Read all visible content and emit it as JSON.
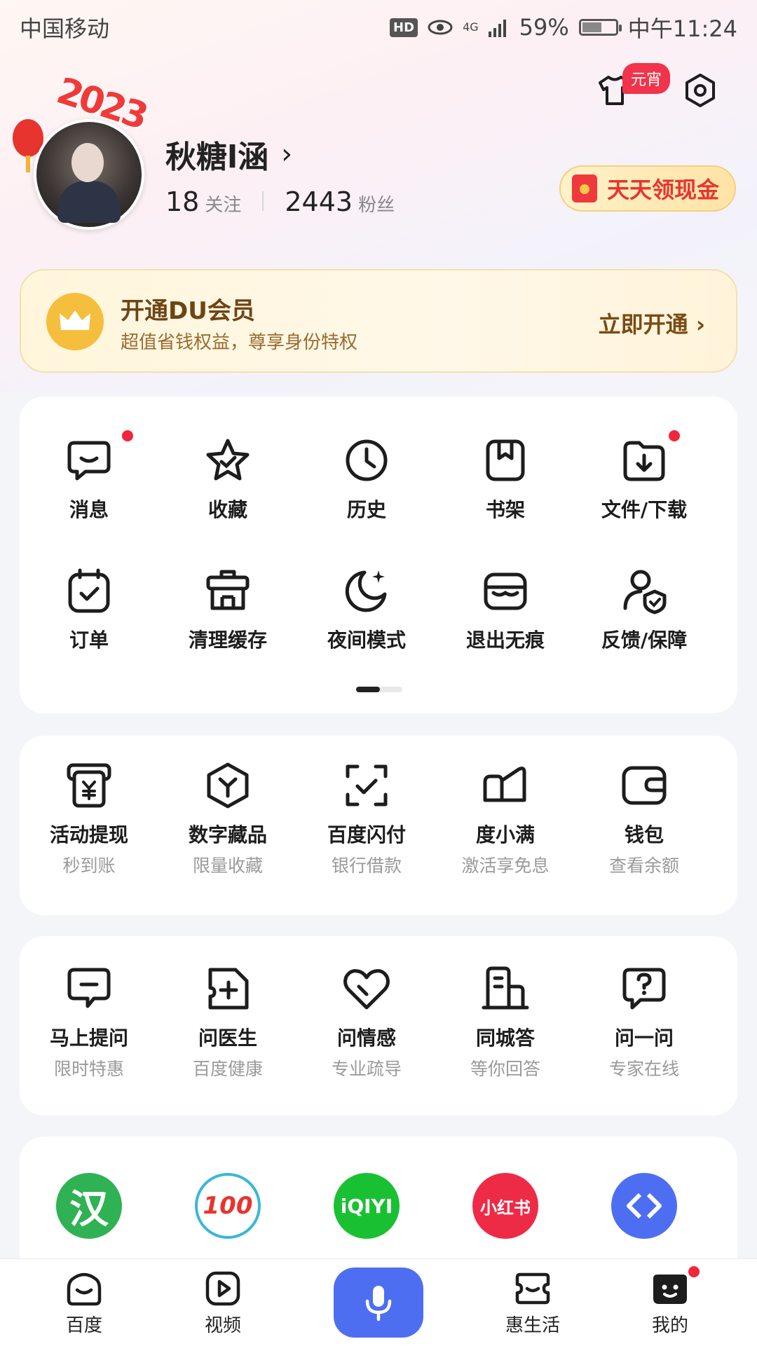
{
  "status_bar": {
    "carrier": "中国移动",
    "hd": "HD",
    "network": "4G",
    "battery": "59%",
    "battery_level": 0.59,
    "time": "中午11:24"
  },
  "profile": {
    "name": "秋糖l涵",
    "year_deco": "2023",
    "follow_count": "18",
    "follow_label": "关注",
    "fans_count": "2443",
    "fans_label": "粉丝",
    "yuanxiao_badge": "元宵",
    "cash_button": "天天领现金"
  },
  "vip": {
    "title": "开通DU会员",
    "subtitle": "超值省钱权益，尊享身份特权",
    "cta": "立即开通"
  },
  "tools": {
    "row1": [
      {
        "label": "消息",
        "icon": "message-icon",
        "dot": true
      },
      {
        "label": "收藏",
        "icon": "star-icon",
        "dot": false
      },
      {
        "label": "历史",
        "icon": "clock-icon",
        "dot": false
      },
      {
        "label": "书架",
        "icon": "bookshelf-icon",
        "dot": false
      },
      {
        "label": "文件/下载",
        "icon": "download-folder-icon",
        "dot": true
      }
    ],
    "row2": [
      {
        "label": "订单",
        "icon": "order-icon"
      },
      {
        "label": "清理缓存",
        "icon": "trash-icon"
      },
      {
        "label": "夜间模式",
        "icon": "moon-icon"
      },
      {
        "label": "退出无痕",
        "icon": "incognito-icon"
      },
      {
        "label": "反馈/保障",
        "icon": "feedback-shield-icon"
      }
    ]
  },
  "finance": [
    {
      "label": "活动提现",
      "sub": "秒到账",
      "icon": "withdraw-icon"
    },
    {
      "label": "数字藏品",
      "sub": "限量收藏",
      "icon": "hexagon-collectible-icon"
    },
    {
      "label": "百度闪付",
      "sub": "银行借款",
      "icon": "scan-pay-icon"
    },
    {
      "label": "度小满",
      "sub": "激活享免息",
      "icon": "duxiaoman-icon"
    },
    {
      "label": "钱包",
      "sub": "查看余额",
      "icon": "wallet-icon"
    }
  ],
  "ask": [
    {
      "label": "马上提问",
      "sub": "限时特惠",
      "icon": "ask-bubble-icon"
    },
    {
      "label": "问医生",
      "sub": "百度健康",
      "icon": "doctor-icon"
    },
    {
      "label": "问情感",
      "sub": "专业疏导",
      "icon": "heart-icon"
    },
    {
      "label": "同城答",
      "sub": "等你回答",
      "icon": "building-icon"
    },
    {
      "label": "问一问",
      "sub": "专家在线",
      "icon": "question-icon"
    }
  ],
  "apps": [
    {
      "text": "汉",
      "icon": "hanyu-app-icon",
      "color": "#2fb254"
    },
    {
      "text": "100",
      "icon": "zuoyebang-app-icon",
      "color": "#ffffff"
    },
    {
      "text": "iQIYI",
      "icon": "iqiyi-app-icon",
      "color": "#19c132"
    },
    {
      "text": "小红书",
      "icon": "xiaohongshu-app-icon",
      "color": "#ee2b47"
    },
    {
      "text": "",
      "icon": "blue-app-icon",
      "color": "#4e6ef2"
    }
  ],
  "nav": {
    "home": "百度",
    "video": "视频",
    "life": "惠生活",
    "mine": "我的"
  },
  "colors": {
    "accent": "#4e6ef2",
    "red": "#f0263d",
    "vip_brown": "#6e4515"
  }
}
